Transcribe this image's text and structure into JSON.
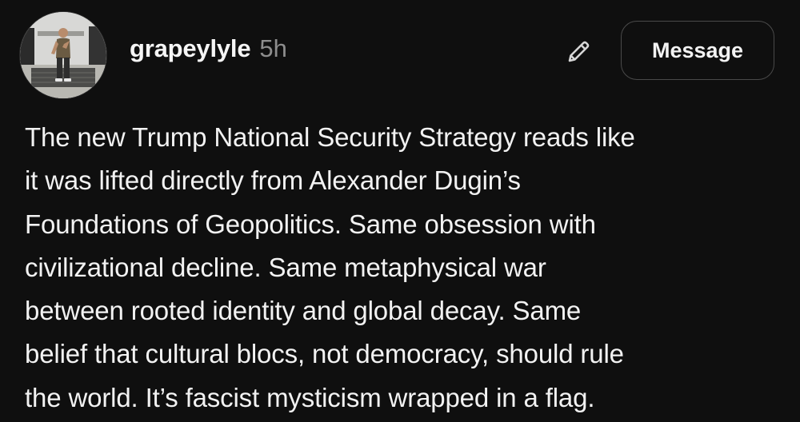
{
  "post": {
    "author": {
      "username": "grapeylyle",
      "timestamp": "5h",
      "avatar_icon": "profile-photo"
    },
    "actions": {
      "edit_icon": "pencil-icon",
      "message_label": "Message"
    },
    "body_lines": [
      "The new Trump National Security Strategy reads like",
      "it was lifted directly from Alexander Dugin’s",
      "Foundations of Geopolitics. Same obsession with",
      "civilizational decline. Same metaphysical war",
      "between rooted identity and global decay. Same",
      "belief that cultural blocs, not democracy, should rule",
      "the world. It’s fascist mysticism wrapped in a flag."
    ]
  },
  "colors": {
    "background": "#0f0f0f",
    "text": "#f2f2f2",
    "muted": "#8d8d8d",
    "button_border": "#4a4a4a"
  }
}
